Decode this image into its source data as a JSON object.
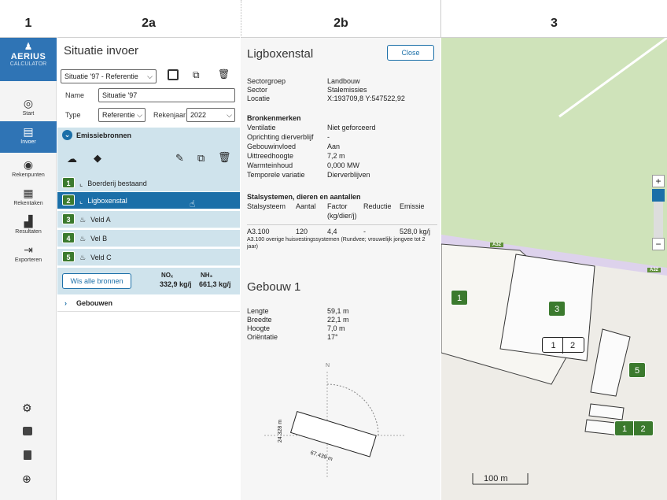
{
  "columns": {
    "c1": "1",
    "c2a": "2a",
    "c2b": "2b",
    "c3": "3"
  },
  "nav": {
    "logo": "AERIUS",
    "logo_sub": "CALCULATOR",
    "items": [
      {
        "label": "Start",
        "icon": "target-icon"
      },
      {
        "label": "Invoer",
        "icon": "clipboard-icon"
      },
      {
        "label": "Rekenpunten",
        "icon": "location-pin-icon"
      },
      {
        "label": "Rekentaken",
        "icon": "calculator-icon"
      },
      {
        "label": "Resultaten",
        "icon": "chart-icon"
      },
      {
        "label": "Exporteren",
        "icon": "export-icon"
      }
    ]
  },
  "panel2a": {
    "title": "Situatie invoer",
    "situation_select": "Situatie '97 - Referentie",
    "name_label": "Name",
    "name_value": "Situatie '97",
    "type_label": "Type",
    "type_value": "Referentie",
    "year_label": "Rekenjaar",
    "year_value": "2022",
    "emission_section": "Emissiebronnen",
    "sources": [
      {
        "num": "1",
        "label": "Boerderij bestaand"
      },
      {
        "num": "2",
        "label": "Ligboxenstal"
      },
      {
        "num": "3",
        "label": "Veld A"
      },
      {
        "num": "4",
        "label": "Vel B"
      },
      {
        "num": "5",
        "label": "Veld C"
      }
    ],
    "clear_button": "Wis alle bronnen",
    "nox_label": "NOₓ",
    "nox_value": "332,9 kg/j",
    "nh3_label": "NH₃",
    "nh3_value": "661,3 kg/j",
    "buildings_section": "Gebouwen"
  },
  "panel2b": {
    "title": "Ligboxenstal",
    "close_button": "Close",
    "general": [
      {
        "k": "Sectorgroep",
        "v": "Landbouw"
      },
      {
        "k": "Sector",
        "v": "Stalemissies"
      },
      {
        "k": "Locatie",
        "v": "X:193709,8 Y:547522,92"
      }
    ],
    "source_heading": "Bronkenmerken",
    "source_props": [
      {
        "k": "Ventilatie",
        "v": "Niet geforceerd"
      },
      {
        "k": "Oprichting dierverblijf",
        "v": "-"
      },
      {
        "k": "Gebouwinvloed",
        "v": "Aan"
      },
      {
        "k": "Uittreedhoogte",
        "v": "7,2 m"
      },
      {
        "k": "Warmteinhoud",
        "v": "0,000 MW"
      },
      {
        "k": "Temporele variatie",
        "v": "Dierverblijven"
      }
    ],
    "stal_heading": "Stalsystemen, dieren en aantallen",
    "stal_cols": [
      "Stalsysteem",
      "Aantal",
      "Factor",
      "Reductie",
      "Emissie"
    ],
    "stal_unit": "(kg/dier/j)",
    "stal_row": [
      "A3.100",
      "120",
      "4,4",
      "-",
      "528,0 kg/j"
    ],
    "stal_note": "A3.100 overige huisvestingssystemen (Rundvee; vrouwelijk jongvee tot 2 jaar)",
    "building_title": "Gebouw 1",
    "building_props": [
      {
        "k": "Lengte",
        "v": "59,1 m"
      },
      {
        "k": "Breedte",
        "v": "22,1 m"
      },
      {
        "k": "Hoogte",
        "v": "7,0 m"
      },
      {
        "k": "Oriëntatie",
        "v": "17°"
      }
    ],
    "compass_n": "N",
    "dim_width": "24.328 m",
    "dim_length": "67.439 m"
  },
  "map": {
    "road_label": "A32",
    "road_label2": "A32",
    "zoom_in": "+",
    "zoom_out": "−",
    "scale": "100 m",
    "markers": [
      "1",
      "3",
      "5",
      "1",
      "2"
    ],
    "multi_marker": [
      "1",
      "2"
    ]
  },
  "colors": {
    "accent": "#2f74b5",
    "badge": "#3b7a2e",
    "section": "#cfe3ec",
    "selected": "#1b6fa8"
  }
}
